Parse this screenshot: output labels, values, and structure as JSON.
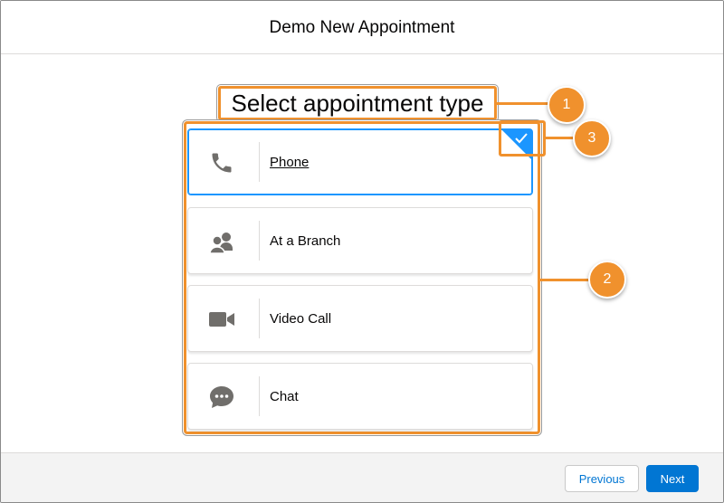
{
  "header": {
    "title": "Demo New Appointment"
  },
  "heading": "Select appointment type",
  "options": [
    {
      "label": "Phone",
      "icon": "phone-icon",
      "selected": true
    },
    {
      "label": "At a Branch",
      "icon": "people-icon",
      "selected": false
    },
    {
      "label": "Video Call",
      "icon": "video-camera-icon",
      "selected": false
    },
    {
      "label": "Chat",
      "icon": "chat-icon",
      "selected": false
    }
  ],
  "callouts": {
    "c1": "1",
    "c2": "2",
    "c3": "3"
  },
  "footer": {
    "previous_label": "Previous",
    "next_label": "Next"
  },
  "colors": {
    "accent": "#f0912d",
    "brand": "#0176d3",
    "selected_border": "#1b96ff",
    "icon_gray": "#706e6b"
  }
}
